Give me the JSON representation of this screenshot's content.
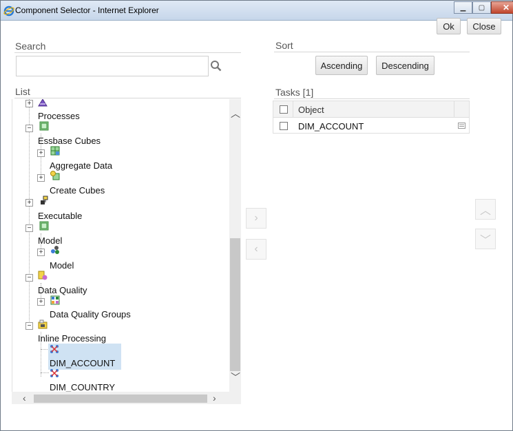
{
  "window": {
    "title": "Component Selector - Internet Explorer",
    "minimize_glyph": "▁",
    "maximize_glyph": "▢",
    "close_glyph": "✕"
  },
  "toolbar": {
    "ok_label": "Ok",
    "close_label": "Close"
  },
  "search": {
    "label": "Search",
    "value": "",
    "placeholder": ""
  },
  "sort": {
    "label": "Sort",
    "ascending_label": "Ascending",
    "descending_label": "Descending"
  },
  "list": {
    "label": "List",
    "items": [
      {
        "label": "Processes",
        "icon": "processes-icon",
        "expander": "+"
      },
      {
        "label": "Essbase Cubes",
        "icon": "essbase-cubes-icon",
        "expander": "−"
      },
      {
        "label": "Aggregate Data",
        "icon": "aggregate-data-icon",
        "expander": "+"
      },
      {
        "label": "Create Cubes",
        "icon": "create-cubes-icon",
        "expander": "+"
      },
      {
        "label": "Executable",
        "icon": "executable-icon",
        "expander": "+"
      },
      {
        "label": "Model",
        "icon": "model-folder-icon",
        "expander": "−"
      },
      {
        "label": "Model",
        "icon": "model-icon",
        "expander": "+"
      },
      {
        "label": "Data Quality",
        "icon": "data-quality-icon",
        "expander": "−"
      },
      {
        "label": "Data Quality Groups",
        "icon": "data-quality-groups-icon",
        "expander": "+"
      },
      {
        "label": "Inline Processing",
        "icon": "inline-processing-icon",
        "expander": "−"
      },
      {
        "label": "DIM_ACCOUNT",
        "icon": "dimension-icon",
        "expander": "",
        "selected": true
      },
      {
        "label": "DIM_COUNTRY",
        "icon": "dimension-icon",
        "expander": ""
      }
    ]
  },
  "tasks": {
    "label": "Tasks [1]",
    "column_header": "Object",
    "rows": [
      {
        "object": "DIM_ACCOUNT"
      }
    ]
  },
  "move": {
    "add_glyph": "›",
    "remove_glyph": "‹",
    "up_glyph": "︿",
    "down_glyph": "﹀"
  },
  "colors": {
    "selection": "#cfe2f3",
    "titlebar": "#c6d6ea",
    "close_button": "#c0452c"
  }
}
